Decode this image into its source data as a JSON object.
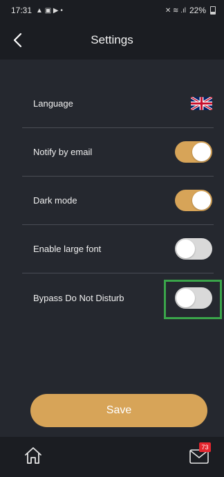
{
  "status_bar": {
    "time": "17:31",
    "battery": "22%"
  },
  "header": {
    "title": "Settings"
  },
  "settings": [
    {
      "label": "Language",
      "control": "flag",
      "icon": "uk-flag-icon"
    },
    {
      "label": "Notify by email",
      "control": "toggle",
      "on": true
    },
    {
      "label": "Dark mode",
      "control": "toggle",
      "on": true
    },
    {
      "label": "Enable large font",
      "control": "toggle",
      "on": false
    },
    {
      "label": "Bypass Do Not Disturb",
      "control": "toggle",
      "on": false
    }
  ],
  "save_label": "Save",
  "bottom_nav": {
    "home_icon": "home-icon",
    "mail_icon": "mail-icon",
    "mail_badge": "73"
  },
  "colors": {
    "accent": "#d7a458",
    "background": "#25282f",
    "bar": "#1b1d22",
    "toggle_off": "#d9d9d9",
    "highlight": "#3aa54a",
    "badge": "#e3262e"
  }
}
